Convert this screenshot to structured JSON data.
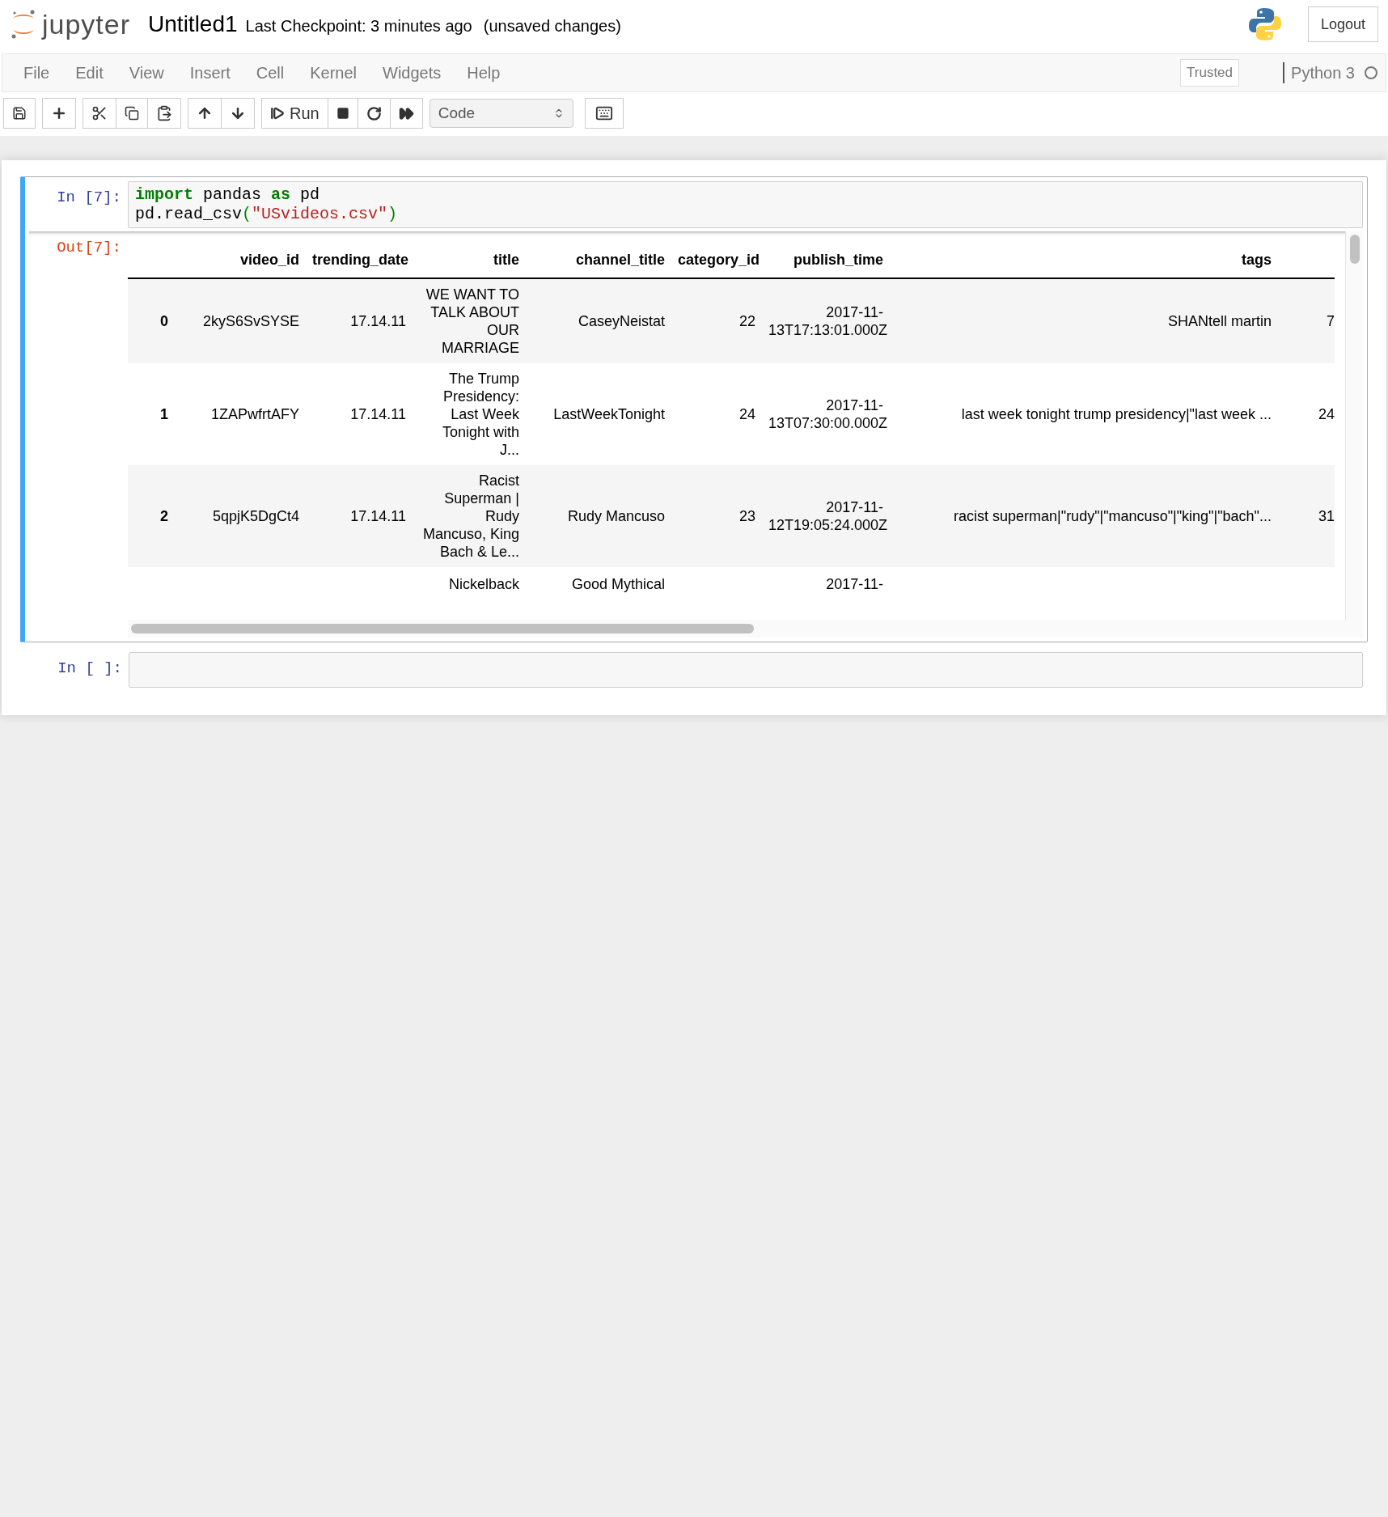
{
  "header": {
    "logo_text": "jupyter",
    "notebook_name": "Untitled1",
    "checkpoint": "Last Checkpoint: 3 minutes ago",
    "save_status": "(unsaved changes)",
    "logout": "Logout"
  },
  "menu": [
    "File",
    "Edit",
    "View",
    "Insert",
    "Cell",
    "Kernel",
    "Widgets",
    "Help"
  ],
  "notebook_status": {
    "trusted": "Trusted",
    "kernel": "Python 3",
    "kernel_busy": false
  },
  "toolbar": {
    "run": "Run",
    "cell_type": "Code"
  },
  "cells": [
    {
      "selected": true,
      "prompt": "In [7]:",
      "code": [
        [
          {
            "t": "import",
            "kind": "keyword"
          },
          {
            "t": " pandas ",
            "kind": "plain"
          },
          {
            "t": "as",
            "kind": "keyword"
          },
          {
            "t": " pd",
            "kind": "plain"
          }
        ],
        [
          {
            "t": "pd.read_csv",
            "kind": "plain"
          },
          {
            "t": "(",
            "kind": "paren"
          },
          {
            "t": "\"USvideos.csv\"",
            "kind": "string"
          },
          {
            "t": ")",
            "kind": "paren"
          }
        ]
      ],
      "output": {
        "prompt": "Out[7]:",
        "table": {
          "columns": [
            "",
            "video_id",
            "trending_date",
            "title",
            "channel_title",
            "category_id",
            "publish_time",
            "tags",
            ""
          ],
          "rows": [
            [
              "0",
              "2kyS6SvSYSE",
              "17.14.11",
              "WE WANT TO TALK ABOUT OUR MARRIAGE",
              "CaseyNeistat",
              "22",
              "2017-11-13T17:13:01.000Z",
              "SHANtell martin",
              "7"
            ],
            [
              "1",
              "1ZAPwfrtAFY",
              "17.14.11",
              "The Trump Presidency: Last Week Tonight with J...",
              "LastWeekTonight",
              "24",
              "2017-11-13T07:30:00.000Z",
              "last week tonight trump presidency|\"last week ...",
              "24"
            ],
            [
              "2",
              "5qpjK5DgCt4",
              "17.14.11",
              "Racist Superman | Rudy Mancuso, King Bach & Le...",
              "Rudy Mancuso",
              "23",
              "2017-11-12T19:05:24.000Z",
              "racist superman|\"rudy\"|\"mancuso\"|\"king\"|\"bach\"...",
              "31"
            ],
            [
              "",
              "",
              "",
              "Nickelback",
              "Good Mythical",
              "",
              "2017-11-",
              "",
              ""
            ]
          ]
        }
      }
    },
    {
      "selected": false,
      "prompt": "In [ ]:"
    }
  ]
}
